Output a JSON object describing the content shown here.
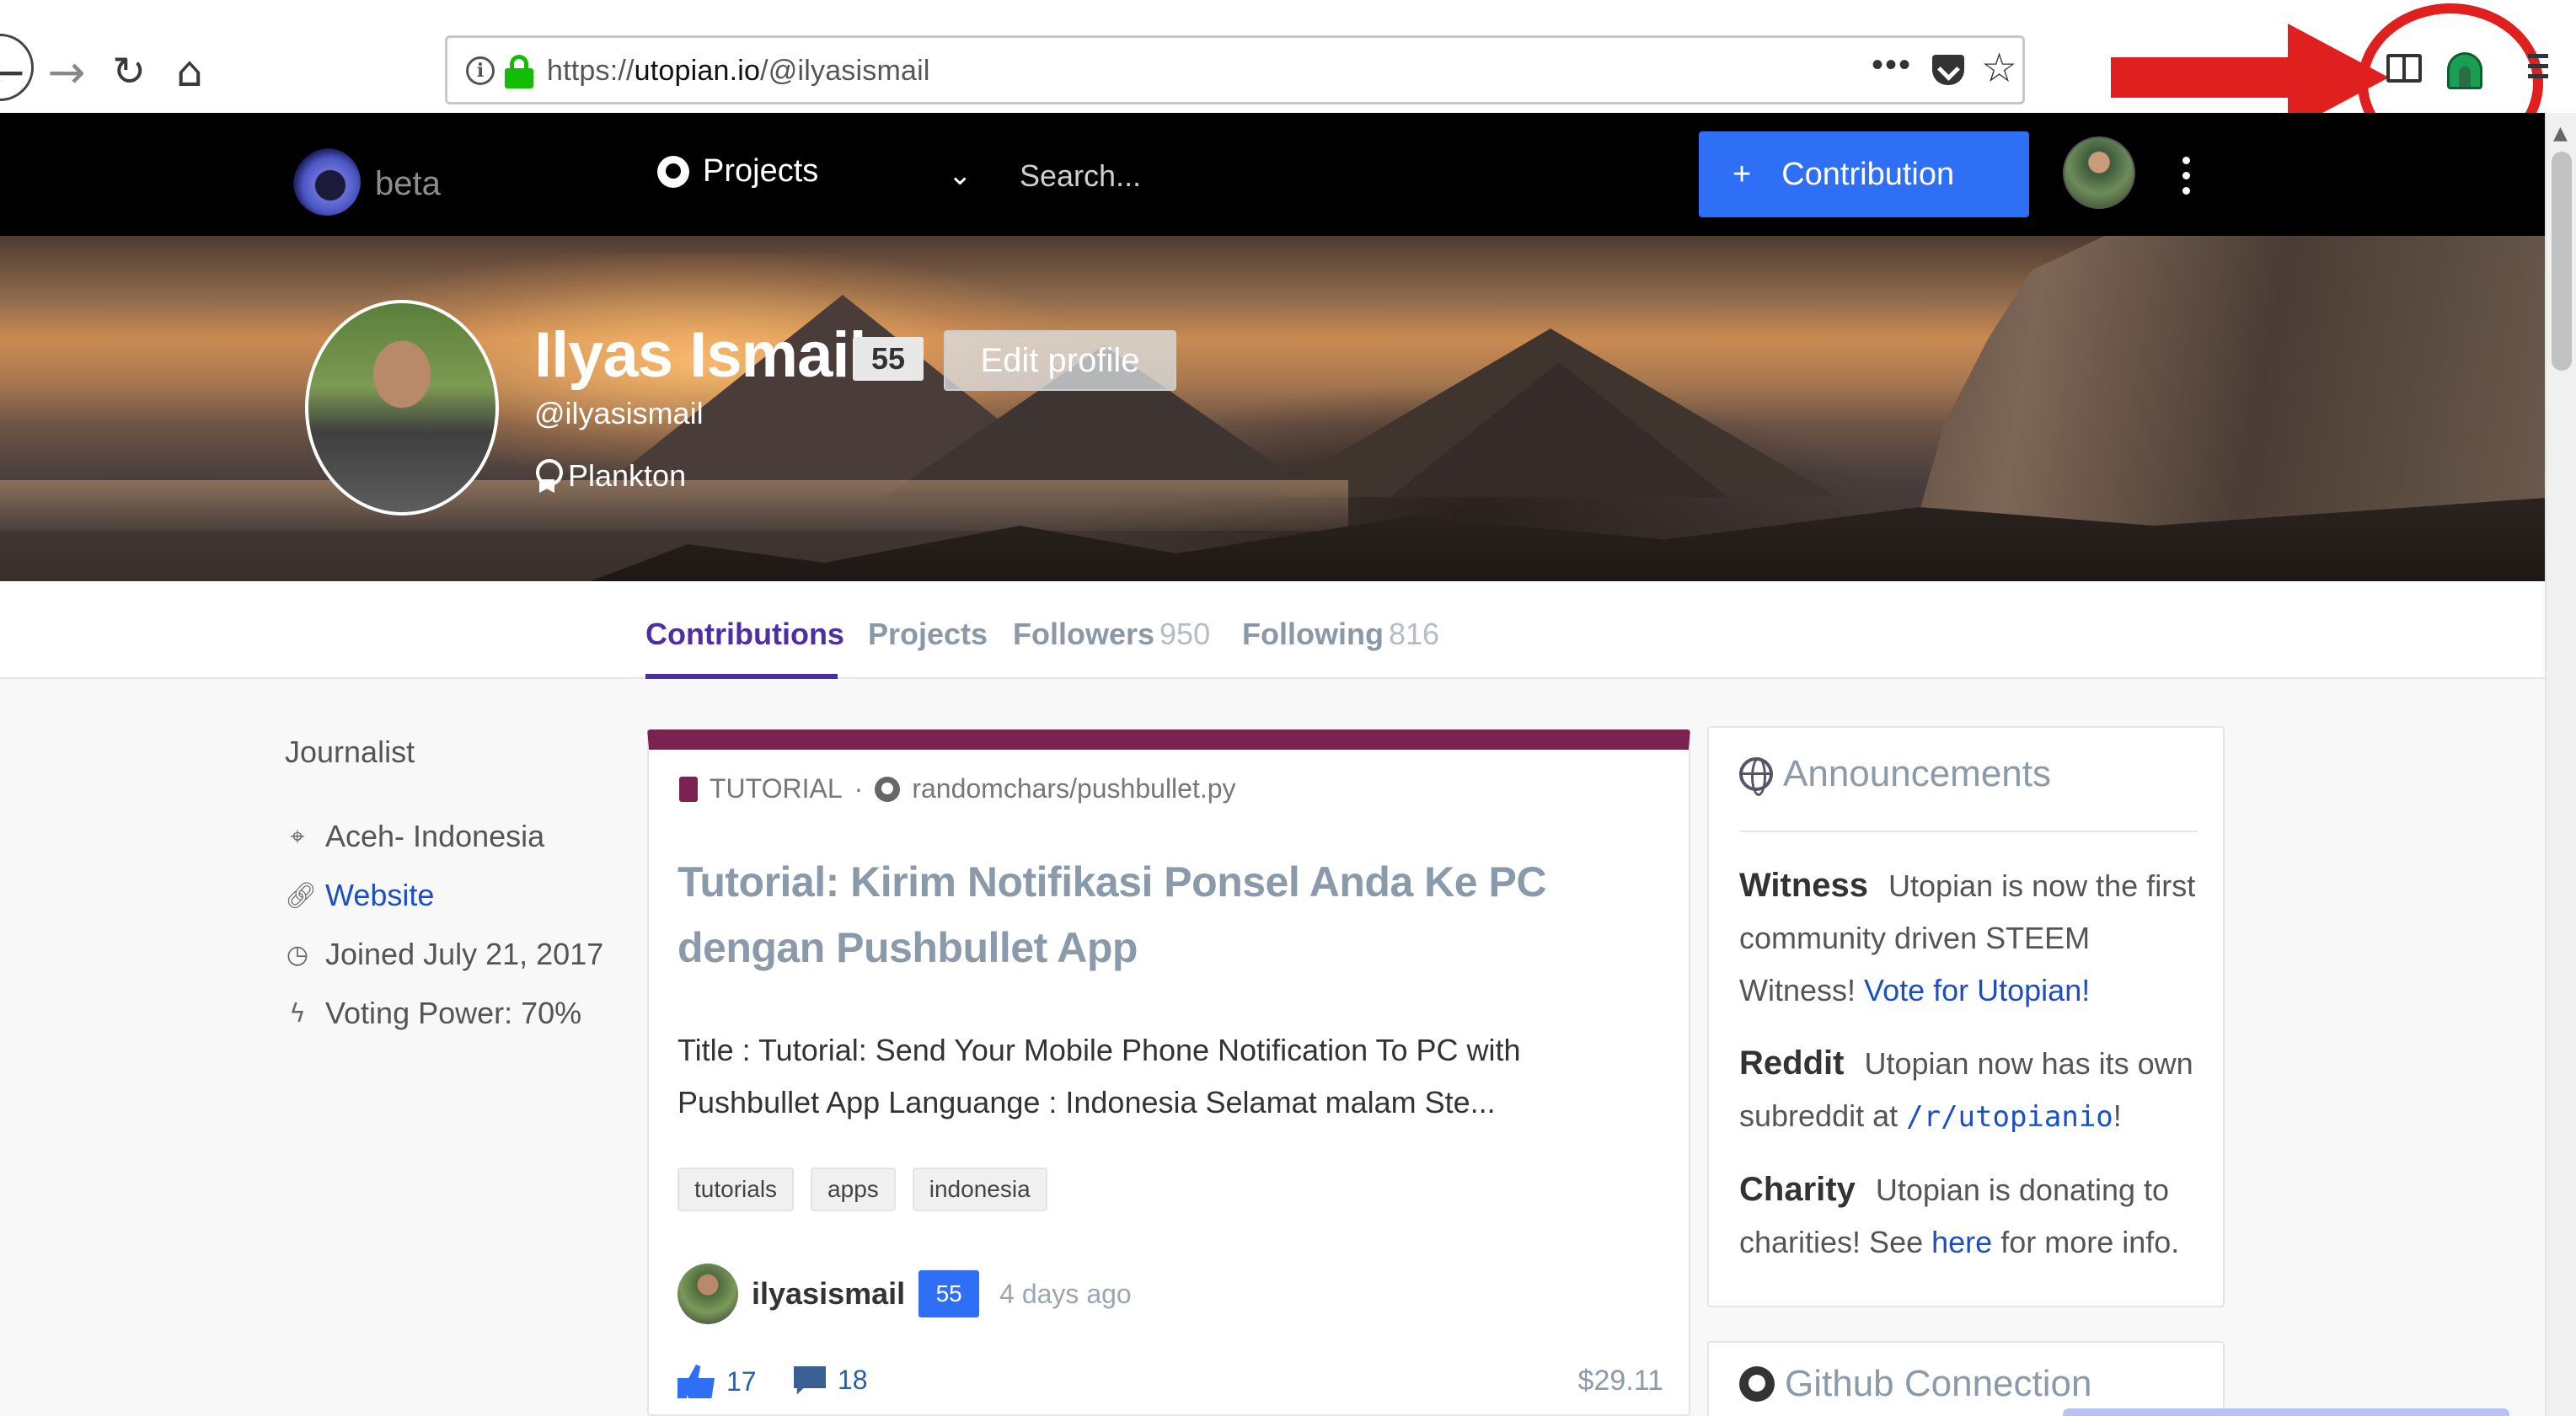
{
  "browser": {
    "url_prefix": "https://",
    "url_host": "utopian.io",
    "url_path": "/@ilyasismail",
    "more_label": "•••",
    "info_glyph": "i",
    "icons": [
      "back-icon",
      "forward-icon",
      "reload-icon",
      "home-icon",
      "info-icon",
      "lock-icon",
      "more-icon",
      "pocket-icon",
      "bookmark-star-icon",
      "reader-view-icon",
      "extension-icon",
      "menu-icon"
    ],
    "annotation_color": "#e0201e"
  },
  "header": {
    "logo_text": "beta",
    "projects_label": "Projects",
    "search_placeholder": "Search...",
    "contribution_plus": "+",
    "contribution_label": "Contribution",
    "accent": "#2f6ff5"
  },
  "profile": {
    "name": "Ilyas Ismail",
    "reputation": "55",
    "edit_label": "Edit profile",
    "handle": "@ilyasismail",
    "rank": "Plankton"
  },
  "tabs": [
    {
      "label": "Contributions",
      "count": ""
    },
    {
      "label": "Projects",
      "count": ""
    },
    {
      "label": "Followers",
      "count": "950"
    },
    {
      "label": "Following",
      "count": "816"
    }
  ],
  "sidebar": {
    "title": "Journalist",
    "location": "Aceh- Indonesia",
    "website": "Website",
    "joined": "Joined July 21, 2017",
    "voting_power": "Voting Power: 70%"
  },
  "post": {
    "category": "TUTORIAL",
    "separator": "·",
    "repo": "randomchars/pushbullet.py",
    "title": "Tutorial: Kirim Notifikasi Ponsel Anda Ke PC dengan Pushbullet App",
    "body": "Title : Tutorial: Send Your Mobile Phone Notification To PC with Pushbullet App Languange : Indonesia Selamat malam Ste...",
    "tags": [
      "tutorials",
      "apps",
      "indonesia"
    ],
    "author": "ilyasismail",
    "author_rep": "55",
    "time": "4 days ago",
    "likes": "17",
    "comments": "18",
    "payout": "$29.11",
    "accent": "#7b2350"
  },
  "announcements": {
    "title": "Announcements",
    "witness_label": "Witness",
    "witness_text": "Utopian is now the first community driven STEEM Witness!",
    "witness_link": "Vote for Utopian!",
    "reddit_label": "Reddit",
    "reddit_text": "Utopian now has its own subreddit at",
    "reddit_code": "/r/utopianio",
    "reddit_end": "!",
    "charity_label": "Charity",
    "charity_text": "Utopian is donating to charities! See",
    "charity_link": "here",
    "charity_end": "for more info."
  },
  "github": {
    "title": "Github Connection"
  }
}
